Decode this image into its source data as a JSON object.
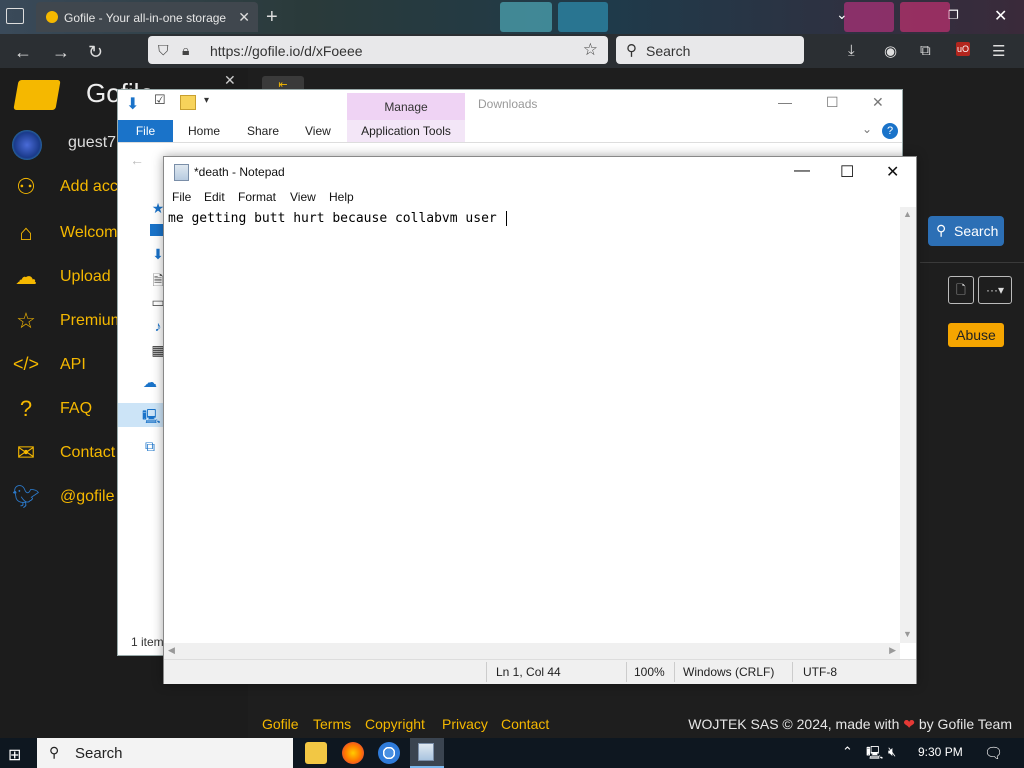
{
  "browser": {
    "tab_title": "Gofile - Your all-in-one storage",
    "new_tab": "+",
    "url": "https://gofile.io/d/xFoeee",
    "search_placeholder": "Search",
    "icons": [
      "tab-list-icon",
      "back-icon",
      "forward-icon",
      "reload-icon",
      "lock-icon",
      "bookmark-star-icon",
      "search-icon",
      "downloads-icon",
      "account-icon",
      "extensions-icon",
      "ublock-icon",
      "menu-icon"
    ]
  },
  "site": {
    "brand": "Gofile",
    "user": "guest7",
    "nav": [
      {
        "label": "Add acc",
        "icon": "add-user-icon"
      },
      {
        "label": "Welcom",
        "icon": "home-icon"
      },
      {
        "label": "Upload",
        "icon": "upload-icon"
      },
      {
        "label": "Premium",
        "icon": "star-icon"
      },
      {
        "label": "API",
        "icon": "code-icon"
      },
      {
        "label": "FAQ",
        "icon": "question-icon"
      },
      {
        "label": "Contact",
        "icon": "mail-icon"
      },
      {
        "label": "@gofile",
        "icon": "twitter-icon"
      }
    ],
    "search_button": "Search",
    "abuse_button": "Abuse",
    "footer_links": [
      "Gofile",
      "Terms",
      "Copyright",
      "Privacy",
      "Contact"
    ],
    "footer_credit_pre": "WOJTEK SAS © 2024, made with",
    "footer_credit_post": "by Gofile Team",
    "accent_color": "#f5b800"
  },
  "explorer": {
    "context_tab": "Manage",
    "window_title": "Downloads",
    "tabs": [
      "File",
      "Home",
      "Share",
      "View"
    ],
    "app_tools": "Application Tools",
    "help": "?",
    "status": "1 item"
  },
  "notepad": {
    "title": "*death - Notepad",
    "menu": [
      "File",
      "Edit",
      "Format",
      "View",
      "Help"
    ],
    "content": "me getting butt hurt because collabvm user ",
    "status": {
      "position": "Ln 1, Col 44",
      "zoom": "100%",
      "line_ending": "Windows (CRLF)",
      "encoding": "UTF-8"
    }
  },
  "taskbar": {
    "search": "Search",
    "time": "9:30 PM",
    "apps": [
      "file-explorer-icon",
      "firefox-icon",
      "chrome-icon",
      "notepad-icon"
    ]
  }
}
